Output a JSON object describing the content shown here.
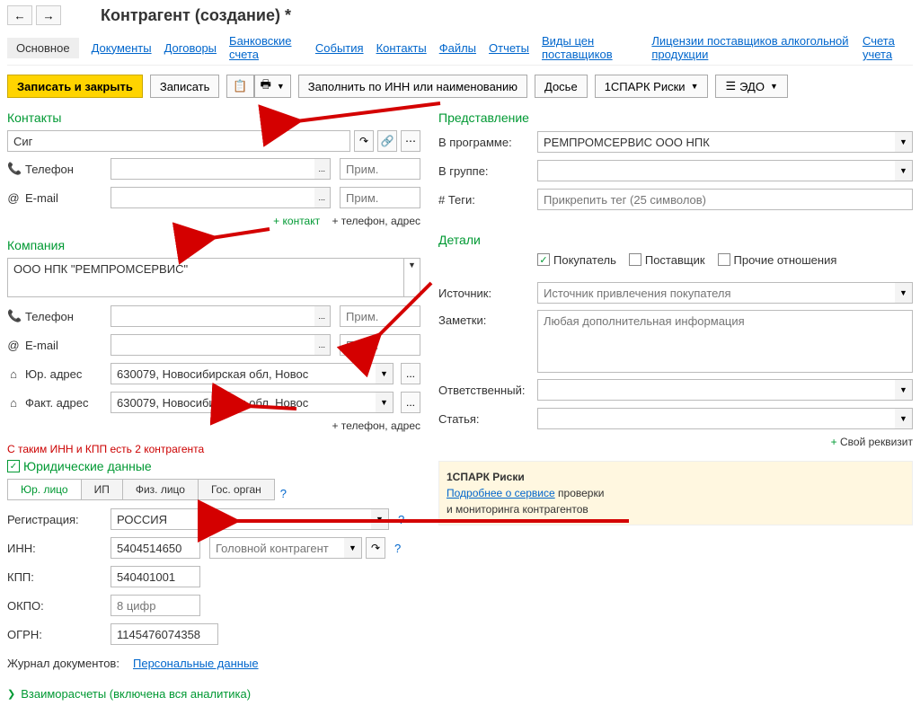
{
  "title": "Контрагент (создание) *",
  "tabs": {
    "main": "Основное",
    "documents": "Документы",
    "contracts": "Договоры",
    "bank": "Банковские счета",
    "events": "События",
    "contacts": "Контакты",
    "files": "Файлы",
    "reports": "Отчеты",
    "price_types": "Виды цен поставщиков",
    "licenses": "Лицензии поставщиков алкогольной продукции",
    "accounts": "Счета учета"
  },
  "toolbar": {
    "save_close": "Записать и закрыть",
    "save": "Записать",
    "fill_inn": "Заполнить по ИНН или наименованию",
    "dossier": "Досье",
    "spark": "1СПАРК Риски",
    "edo": "ЭДО"
  },
  "contacts": {
    "title": "Контакты",
    "name_value": "Сиг",
    "phone_label": "Телефон",
    "email_label": "E-mail",
    "prim_ph": "Прим.",
    "add_contact": "+ контакт",
    "add_phone_addr": "+ телефон, адрес"
  },
  "company": {
    "title": "Компания",
    "value": "ООО НПК \"РЕМПРОМСЕРВИС\"",
    "phone_label": "Телефон",
    "email_label": "E-mail",
    "legal_addr_label": "Юр. адрес",
    "fact_addr_label": "Факт. адрес",
    "addr_value": "630079, Новосибирская обл, Новос",
    "add_phone_addr": "+ телефон, адрес"
  },
  "legal": {
    "duplicate_warn": "С таким ИНН и КПП есть 2 контрагента",
    "title": "Юридические данные",
    "tab_legal": "Юр. лицо",
    "tab_ip": "ИП",
    "tab_person": "Физ. лицо",
    "tab_gov": "Гос. орган",
    "reg_label": "Регистрация:",
    "reg_value": "РОССИЯ",
    "inn_label": "ИНН:",
    "inn_value": "5404514650",
    "head_ph": "Головной контрагент",
    "kpp_label": "КПП:",
    "kpp_value": "540401001",
    "okpo_label": "ОКПО:",
    "okpo_ph": "8 цифр",
    "ogrn_label": "ОГРН:",
    "ogrn_value": "1145476074358",
    "journal_label": "Журнал документов:",
    "journal_link": "Персональные данные"
  },
  "settlements": "Взаиморасчеты (включена вся аналитика)",
  "representation": {
    "title": "Представление",
    "in_program_label": "В программе:",
    "in_program_value": "РЕМПРОМСЕРВИС ООО НПК",
    "in_group_label": "В группе:",
    "tags_label": "# Теги:",
    "tags_ph": "Прикрепить тег (25 символов)"
  },
  "details": {
    "title": "Детали",
    "buyer": "Покупатель",
    "supplier": "Поставщик",
    "other": "Прочие отношения",
    "source_label": "Источник:",
    "source_ph": "Источник привлечения покупателя",
    "notes_label": "Заметки:",
    "notes_ph": "Любая дополнительная информация",
    "resp_label": "Ответственный:",
    "article_label": "Статья:",
    "own_req": "Свой реквизит"
  },
  "spark": {
    "title": "1СПАРК Риски",
    "link": "Подробнее о сервисе",
    "suffix": " проверки",
    "line2": "и мониторинга контрагентов"
  }
}
